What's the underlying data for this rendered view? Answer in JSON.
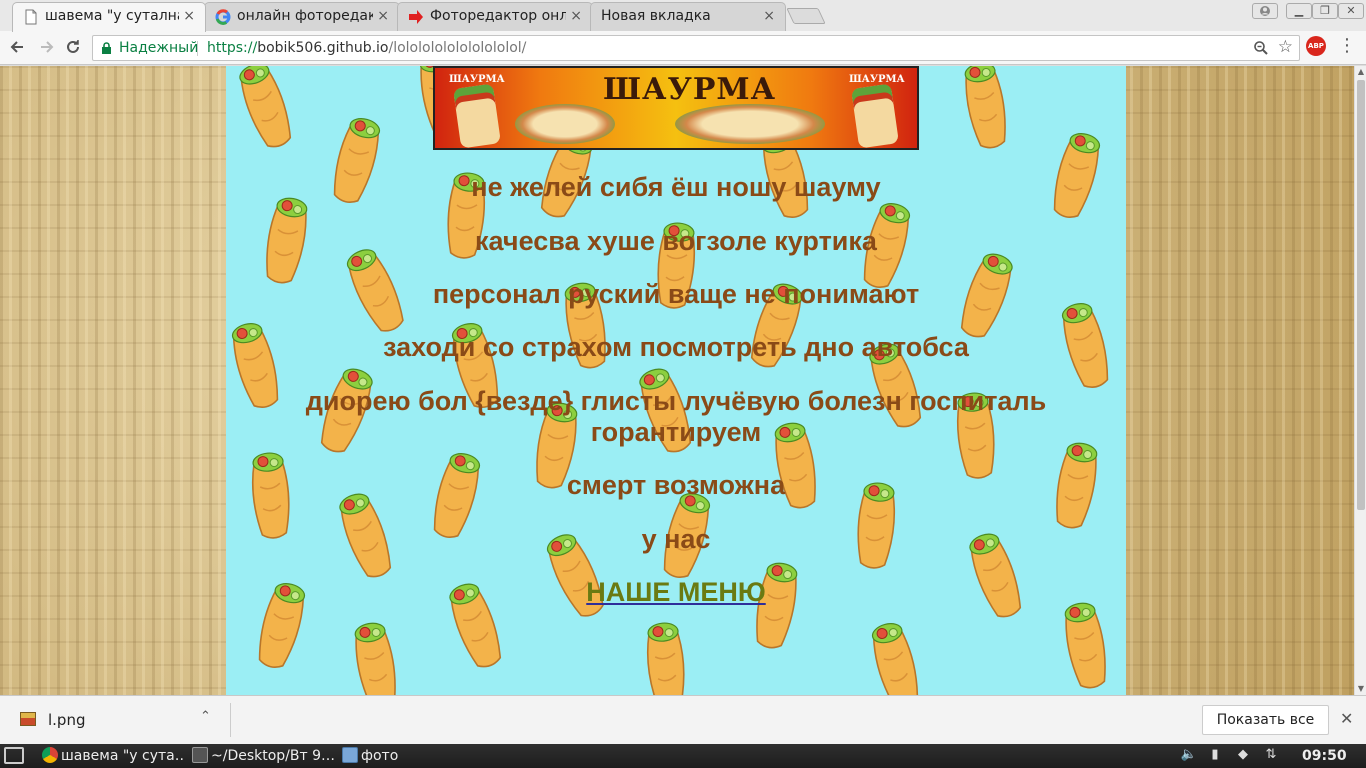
{
  "browser": {
    "tabs": [
      {
        "title": "шавема \"у суталнаТ",
        "favicon": "page-icon",
        "active": true
      },
      {
        "title": "онлайн фоторедак",
        "favicon": "google-icon",
        "active": false
      },
      {
        "title": "Фоторедактор онл",
        "favicon": "red-arrow-icon",
        "active": false
      },
      {
        "title": "Новая вкладка",
        "favicon": "none",
        "active": false
      }
    ],
    "close_glyph": "×",
    "omnibox": {
      "secure_label": "Надежный",
      "url_scheme": "https://",
      "url_host": "bobik506.github.io",
      "url_path": "/lolololololololololol/"
    },
    "extension_badge": "ABP"
  },
  "page": {
    "banner_title": "ШАУРМА",
    "banner_side_label": "ШАУРМА",
    "lines": [
      "не желей сибя ёш ношу шауму",
      "качесва хуше вогзоле куртика",
      "персонал руский ваще не понимают",
      "заходи со страхом посмотреть дно автобса",
      "диорею бол {везде} глисты лучёвую болезн госпиталь",
      "горантируем",
      "смерт возможна",
      "у нас"
    ],
    "menu_link": "НАШЕ МЕНЮ"
  },
  "downloads": {
    "file_name": "l.png",
    "show_all": "Показать все"
  },
  "taskbar": {
    "items": [
      {
        "label": "шавема \"у сута…",
        "icon": "chrome-icon"
      },
      {
        "label": "~/Desktop/Вт 9…",
        "icon": "terminal-icon"
      },
      {
        "label": "фото",
        "icon": "folder-icon"
      }
    ],
    "clock": "09:50"
  },
  "colors": {
    "page_background": "#9beef4",
    "text": "#8a4a17",
    "link": "#6a7a12",
    "secure_green": "#0b8043"
  }
}
